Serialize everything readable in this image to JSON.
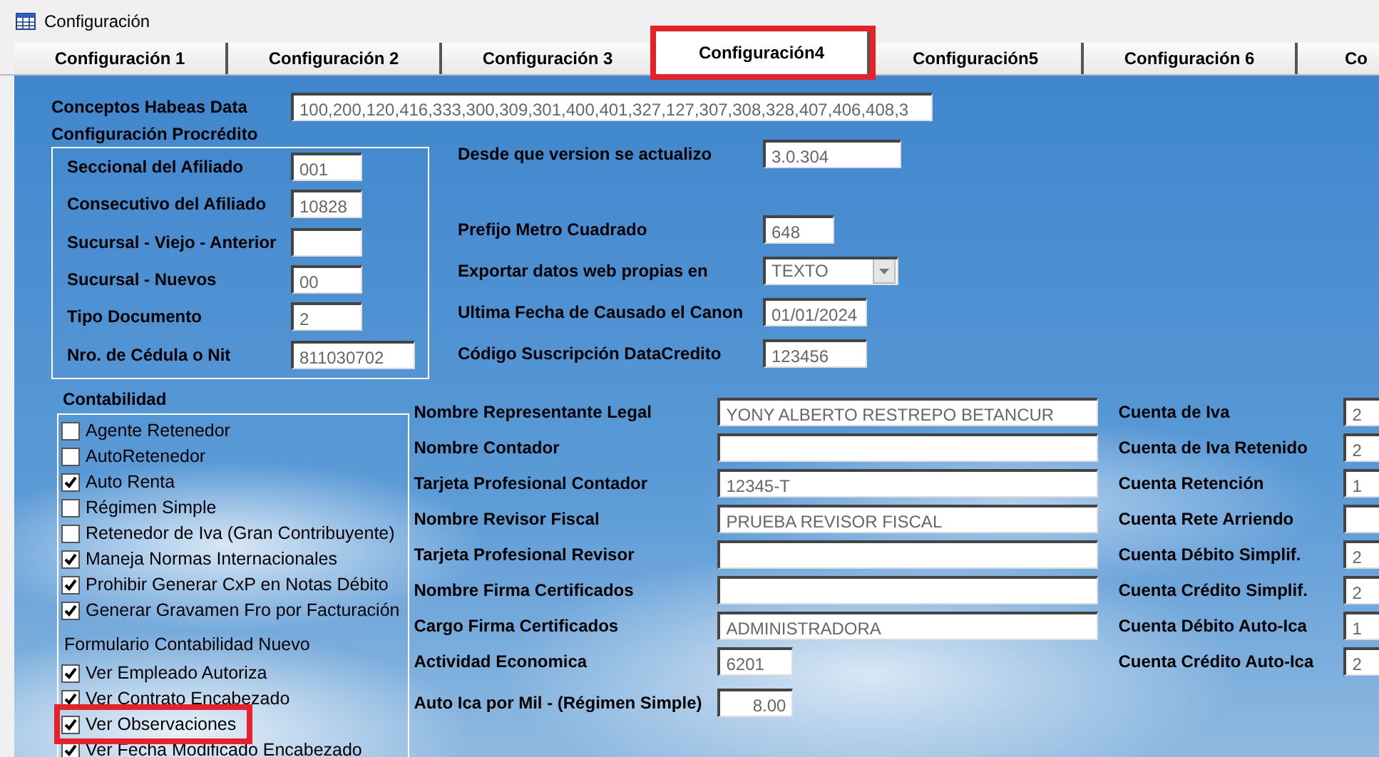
{
  "window": {
    "title": "Configuración"
  },
  "tabs": [
    {
      "label": "Configuración 1",
      "selected": false,
      "highlighted": false
    },
    {
      "label": "Configuración 2",
      "selected": false,
      "highlighted": false
    },
    {
      "label": "Configuración 3",
      "selected": false,
      "highlighted": false
    },
    {
      "label": "Configuración4",
      "selected": true,
      "highlighted": true
    },
    {
      "label": "Configuración5",
      "selected": false,
      "highlighted": false
    },
    {
      "label": "Configuración 6",
      "selected": false,
      "highlighted": false
    },
    {
      "label": "Co",
      "selected": false,
      "highlighted": false
    }
  ],
  "habeas": {
    "label": "Conceptos Habeas Data",
    "value": "100,200,120,416,333,300,309,301,400,401,327,127,307,308,328,407,406,408,3"
  },
  "procredito": {
    "title": "Configuración Procrédito",
    "fields": [
      {
        "label": "Seccional del Afiliado",
        "value": "001",
        "kind": "short"
      },
      {
        "label": "Consecutivo del Afiliado",
        "value": "10828",
        "kind": "short"
      },
      {
        "label": "Sucursal - Viejo - Anterior",
        "kind": "short"
      },
      {
        "label": "Sucursal - Nuevos",
        "value": "00",
        "kind": "short"
      },
      {
        "label": "Tipo Documento",
        "value": "2",
        "kind": "short"
      },
      {
        "label": "Nro. de Cédula o Nit",
        "value": "811030702",
        "kind": "medium"
      }
    ]
  },
  "general_fields": [
    {
      "label": "Desde que version se actualizo",
      "value": "3.0.304",
      "kind": "wide"
    },
    {
      "label": "Prefijo Metro Cuadrado",
      "value": "648",
      "kind": "short"
    },
    {
      "label": "Exportar datos web propias en",
      "value": "TEXTO",
      "kind": "select"
    },
    {
      "label": "Ultima Fecha de Causado el Canon",
      "value": "01/01/2024",
      "kind": "medium"
    },
    {
      "label": "Código Suscripción DataCredito",
      "value": "123456",
      "kind": "medium"
    }
  ],
  "contabilidad": {
    "title": "Contabilidad",
    "options": [
      {
        "label": "Agente Retenedor",
        "checked": false
      },
      {
        "label": "AutoRetenedor",
        "checked": false
      },
      {
        "label": "Auto Renta",
        "checked": true
      },
      {
        "label": "Régimen Simple",
        "checked": false
      },
      {
        "label": "Retenedor de Iva (Gran Contribuyente)",
        "checked": false
      },
      {
        "label": "Maneja Normas Internacionales",
        "checked": true
      },
      {
        "label": "Prohibir Generar CxP en Notas Débito",
        "checked": true
      },
      {
        "label": "Generar Gravamen Fro por Facturación",
        "checked": true
      }
    ],
    "subtitle": "Formulario Contabilidad Nuevo",
    "form_options": [
      {
        "label": "Ver Empleado Autoriza",
        "checked": true,
        "highlighted": false
      },
      {
        "label": "Ver Contrato Encabezado",
        "checked": true,
        "highlighted": false
      },
      {
        "label": "Ver Observaciones",
        "checked": true,
        "highlighted": true
      },
      {
        "label": "Ver Fecha Modificado Encabezado",
        "checked": true,
        "highlighted": false
      }
    ]
  },
  "entity_fields": [
    {
      "label": "Nombre Representante Legal",
      "value": "YONY ALBERTO RESTREPO BETANCUR",
      "kind": "wide"
    },
    {
      "label": "Nombre Contador",
      "kind": "wide"
    },
    {
      "label": "Tarjeta Profesional Contador",
      "value": "12345-T",
      "kind": "wide"
    },
    {
      "label": "Nombre Revisor Fiscal",
      "value": "PRUEBA REVISOR FISCAL",
      "kind": "wide"
    },
    {
      "label": "Tarjeta Profesional Revisor",
      "kind": "wide"
    },
    {
      "label": "Nombre Firma Certificados",
      "kind": "wide"
    },
    {
      "label": "Cargo Firma Certificados",
      "value": "ADMINISTRADORA",
      "kind": "wide"
    },
    {
      "label": "Actividad Economica",
      "value": "6201",
      "kind": "short"
    },
    {
      "label": "Auto Ica por Mil - (Régimen Simple)",
      "value": "8.00",
      "kind": "number"
    }
  ],
  "accounts": [
    {
      "label": "Cuenta de Iva",
      "value": "2"
    },
    {
      "label": "Cuenta de Iva Retenido",
      "value": "2"
    },
    {
      "label": "Cuenta Retención",
      "value": "1"
    },
    {
      "label": "Cuenta Rete Arriendo"
    },
    {
      "label": "Cuenta Débito Simplif.",
      "value": "2"
    },
    {
      "label": "Cuenta Crédito Simplif.",
      "value": "2"
    },
    {
      "label": "Cuenta Débito Auto-Ica",
      "value": "1"
    },
    {
      "label": "Cuenta Crédito  Auto-Ica",
      "value": "2"
    }
  ]
}
